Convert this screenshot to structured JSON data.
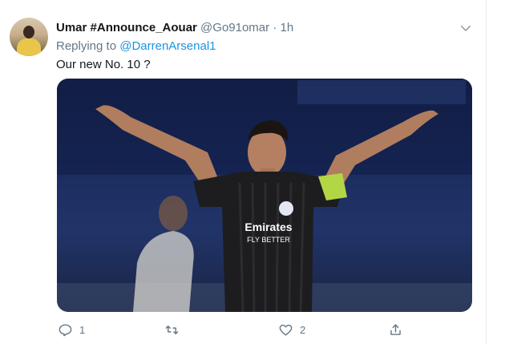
{
  "tweet": {
    "display_name": "Umar #Announce_Aouar",
    "handle": "@Go91omar",
    "separator": "·",
    "time": "1h",
    "replying_prefix": "Replying to",
    "replying_to": "@DarrenArsenal1",
    "text": "Our new No. 10 ?"
  },
  "media": {
    "jersey_sponsor": "Emirates",
    "jersey_sub": "FLY BETTER"
  },
  "actions": {
    "reply_count": "1",
    "retweet_count": "",
    "like_count": "2"
  },
  "colors": {
    "link": "#1b95e0",
    "muted": "#657786",
    "text": "#14171a"
  },
  "icons": [
    "chevron-down-icon",
    "reply-icon",
    "retweet-icon",
    "like-icon",
    "share-icon"
  ]
}
